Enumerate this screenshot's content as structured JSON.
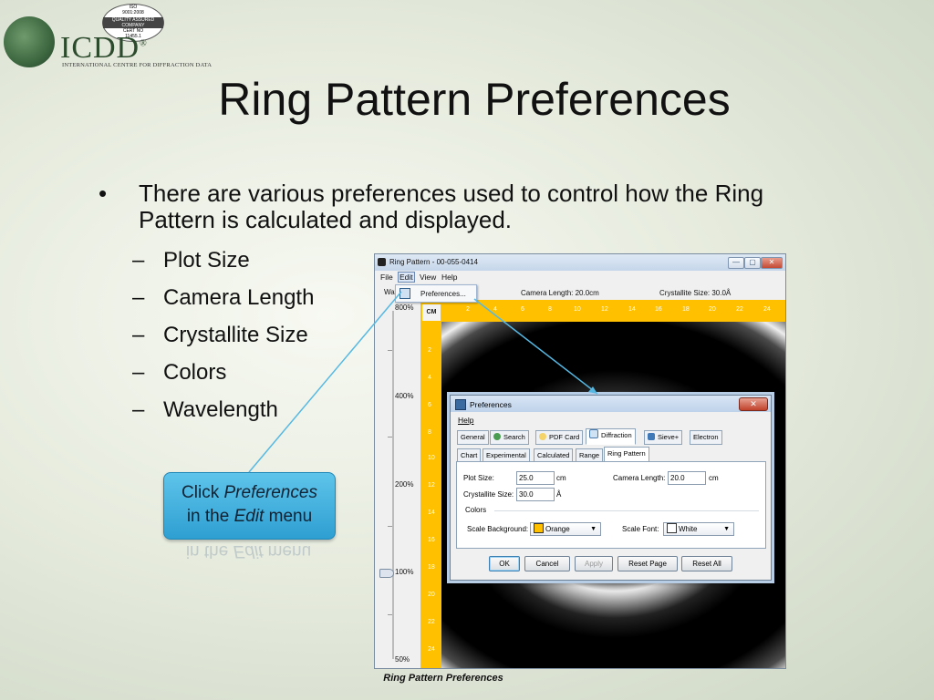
{
  "logo": {
    "iso_line1": "ISO",
    "iso_line2": "9001:2008",
    "iso_bar": "QUALITY ASSURED COMPANY",
    "iso_line3": "CERT NO",
    "iso_line4": "11455.1",
    "name": "ICDD",
    "reg": "®",
    "subtitle": "INTERNATIONAL CENTRE FOR DIFFRACTION DATA"
  },
  "slide": {
    "title": "Ring Pattern Preferences",
    "bullet_symbol": "•",
    "bullet_text": "There are various preferences used to control how the Ring Pattern is calculated and displayed.",
    "dash": "–",
    "sub_items": [
      "Plot Size",
      "Camera Length",
      "Crystallite Size",
      "Colors",
      "Wavelength"
    ],
    "callout": {
      "line1_prefix": "Click ",
      "line1_em": "Preferences",
      "line2_prefix": "in the ",
      "line2_em": "Edit",
      "line2_suffix": " menu"
    },
    "caption": "Ring Pattern Preferences"
  },
  "window": {
    "title": "Ring Pattern - 00-055-0414",
    "menus": [
      "File",
      "Edit",
      "View",
      "Help"
    ],
    "wavelength_label": "Wav",
    "preferences_item": "Preferences...",
    "camera_length": "Camera Length: 20.0cm",
    "crystallite_size": "Crystallite Size: 30.0Å",
    "zoom_levels": [
      "800%",
      "400%",
      "200%",
      "100%",
      "50%"
    ],
    "unit": "CM",
    "top_scale": [
      "2",
      "4",
      "6",
      "8",
      "10",
      "12",
      "14",
      "16",
      "18",
      "20",
      "22",
      "24"
    ],
    "left_scale": [
      "2",
      "4",
      "6",
      "8",
      "10",
      "12",
      "14",
      "16",
      "18",
      "20",
      "22",
      "24"
    ],
    "controls": {
      "minimize": "—",
      "maximize": "▢",
      "close": "✕"
    }
  },
  "dialog": {
    "title": "Preferences",
    "close": "✕",
    "help": "Help",
    "tabs": [
      "General",
      "Search",
      "PDF Card",
      "Diffraction",
      "Sieve+",
      "Electron"
    ],
    "subtabs": [
      "Chart",
      "Experimental",
      "Calculated",
      "Range",
      "Ring Pattern"
    ],
    "plot_size_label": "Plot Size:",
    "plot_size_value": "25.0",
    "plot_size_unit": "cm",
    "camera_length_label": "Camera Length:",
    "camera_length_value": "20.0",
    "camera_length_unit": "cm",
    "crystallite_label": "Crystallite Size:",
    "crystallite_value": "30.0",
    "crystallite_unit": "Å",
    "colors_label": "Colors",
    "scale_bg_label": "Scale Background:",
    "scale_bg_value": "Orange",
    "scale_bg_color": "#ffc000",
    "scale_font_label": "Scale Font:",
    "scale_font_value": "White",
    "scale_font_color": "#ffffff",
    "buttons": [
      "OK",
      "Cancel",
      "Apply",
      "Reset Page",
      "Reset All"
    ]
  },
  "colors": {
    "accent": "#2e9fd2",
    "scale_orange": "#ffc000"
  }
}
